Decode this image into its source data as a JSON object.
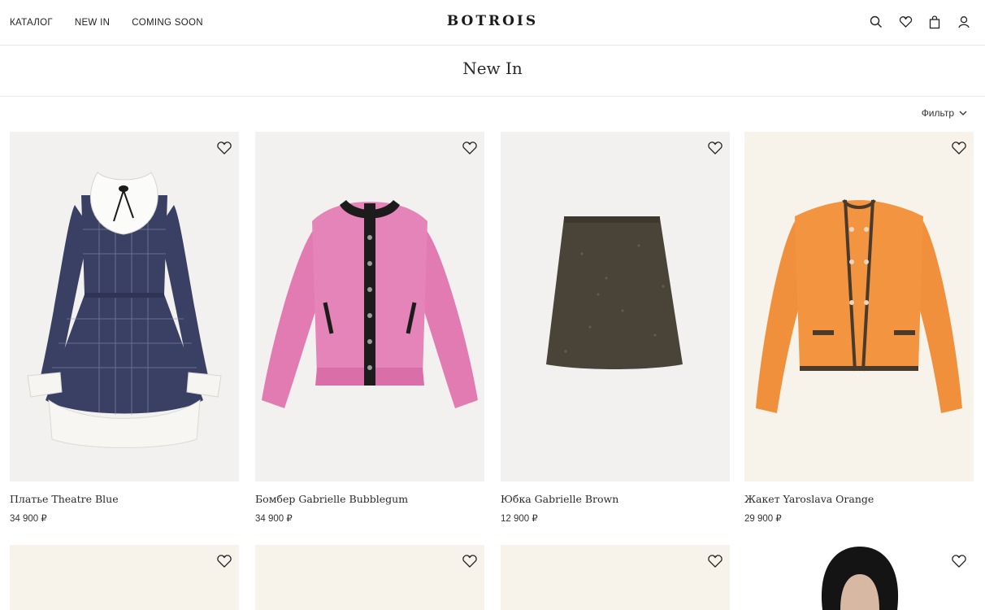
{
  "header": {
    "nav": [
      "КАТАЛОГ",
      "NEW IN",
      "COMING SOON"
    ],
    "logo": "BOTROIS",
    "icons": [
      "search-icon",
      "wishlist-heart-icon",
      "bag-icon",
      "account-icon"
    ]
  },
  "page": {
    "title": "New In",
    "filter_label": "Фильтр"
  },
  "products": [
    {
      "name": "Платье Theatre Blue",
      "price": "34 900 ₽"
    },
    {
      "name": "Бомбер Gabrielle Bubblegum",
      "price": "34 900 ₽"
    },
    {
      "name": "Юбка Gabrielle Brown",
      "price": "12 900 ₽"
    },
    {
      "name": "Жакет Yaroslava Orange",
      "price": "29 900 ₽"
    }
  ],
  "colors": {
    "background": "#ffffff",
    "tile": "#f3f1ef",
    "text": "#1f1f1f",
    "pink": "#e27bb1",
    "orange": "#f0903c",
    "navy": "#3a4063",
    "skirt": "#4a4338"
  }
}
